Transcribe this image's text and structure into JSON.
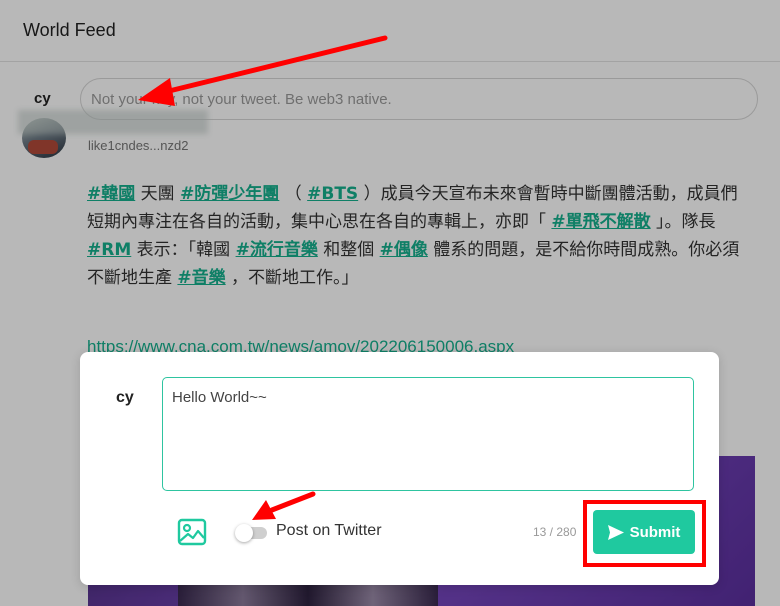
{
  "header": {
    "title": "World Feed"
  },
  "composer": {
    "user": "cy",
    "placeholder": "Not your key, not your tweet. Be web3 native."
  },
  "post": {
    "author": "like1cndes...nzd2",
    "body_segments": [
      {
        "text": "#韓國",
        "tag": true
      },
      {
        "text": " 天團 ",
        "tag": false
      },
      {
        "text": "#防彈少年團",
        "tag": true
      },
      {
        "text": " （ ",
        "tag": false
      },
      {
        "text": "#BTS",
        "tag": true
      },
      {
        "text": " ）成員今天宣布未來會暫時中斷團體活動，成員們短期內專注在各自的活動，集中心思在各自的專輯上，亦即「 ",
        "tag": false
      },
      {
        "text": "#單飛不解散",
        "tag": true
      },
      {
        "text": " 」。隊長 ",
        "tag": false
      },
      {
        "text": "#RM",
        "tag": true
      },
      {
        "text": " 表示：「韓國 ",
        "tag": false
      },
      {
        "text": "#流行音樂",
        "tag": true
      },
      {
        "text": " 和整個 ",
        "tag": false
      },
      {
        "text": "#偶像",
        "tag": true
      },
      {
        "text": " 體系的問題，是不給你時間成熟。你必須不斷地生產 ",
        "tag": false
      },
      {
        "text": "#音樂",
        "tag": true
      },
      {
        "text": " ，不斷地工作。」",
        "tag": false
      }
    ],
    "link": "https://www.cna.com.tw/news/amov/202206150006.aspx"
  },
  "modal": {
    "user": "cy",
    "textarea_value": "Hello World~~",
    "image_icon": "image-icon",
    "twitter_toggle_label": "Post on Twitter",
    "twitter_toggle_on": false,
    "char_count": "13 / 280",
    "submit_label": "Submit",
    "submit_icon": "send-icon"
  },
  "colors": {
    "accent": "#1fc99f",
    "tag": "#16b08e",
    "annotation": "#ff0000"
  }
}
